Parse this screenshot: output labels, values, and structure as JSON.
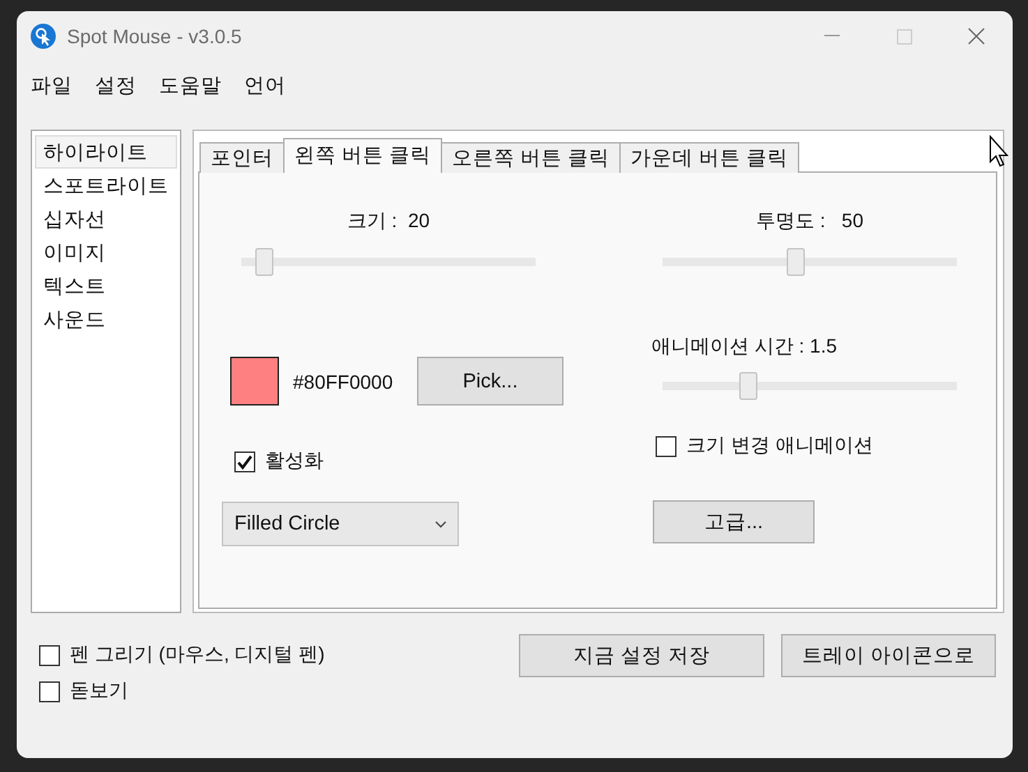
{
  "window": {
    "title": "Spot Mouse - v3.0.5"
  },
  "menu": [
    "파일",
    "설정",
    "도움말",
    "언어"
  ],
  "sidebar": {
    "items": [
      {
        "label": "하이라이트",
        "selected": true
      },
      {
        "label": "스포트라이트",
        "selected": false
      },
      {
        "label": "십자선",
        "selected": false
      },
      {
        "label": "이미지",
        "selected": false
      },
      {
        "label": "텍스트",
        "selected": false
      },
      {
        "label": "사운드",
        "selected": false
      }
    ]
  },
  "tabs": [
    {
      "label": "포인터",
      "selected": false
    },
    {
      "label": "왼쪽 버튼 클릭",
      "selected": true
    },
    {
      "label": "오른쪽 버튼 클릭",
      "selected": false
    },
    {
      "label": "가운데 버튼 클릭",
      "selected": false
    }
  ],
  "panel": {
    "sliders": [
      {
        "label": "크기 :",
        "reading": "20",
        "level": 0.05
      },
      {
        "label": "투명도 :",
        "reading": "50",
        "level": 0.45
      },
      {
        "label": "애니메이션 시간 :",
        "reading": "1.5",
        "level": 0.28
      }
    ],
    "color": {
      "color": "#ff8080",
      "hex": "#80FF0000"
    },
    "pick_button": "Pick...",
    "enabled": {
      "label": "활성화",
      "checked": true
    },
    "shape_dropdown": {
      "value": "Filled Circle"
    },
    "size_animation": {
      "label": "크기 변경 애니메이션",
      "checked": false
    },
    "advanced_button": "고급..."
  },
  "options": [
    {
      "label": "펜 그리기 (마우스, 디지털 펜)",
      "checked": false
    },
    {
      "label": "돋보기",
      "checked": false
    }
  ],
  "buttons": [
    "지금 설정 저장",
    "트레이 아이콘으로"
  ]
}
